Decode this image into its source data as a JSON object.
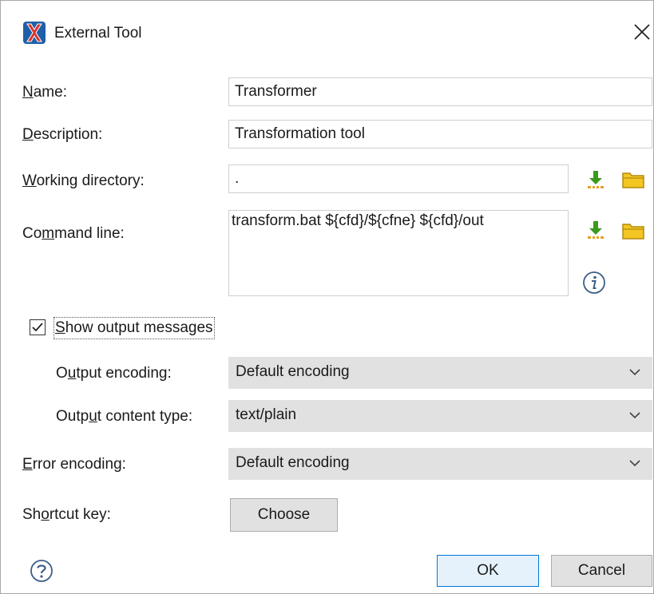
{
  "window": {
    "title": "External Tool"
  },
  "form": {
    "name_label_mnemonic": "N",
    "name_label_rest": "ame:",
    "name_value": "Transformer",
    "description_label_mnemonic": "D",
    "description_label_rest": "escription:",
    "description_value": "Transformation tool",
    "workdir_label_mnemonic": "W",
    "workdir_label_rest": "orking directory:",
    "workdir_value": ".",
    "cmd_label_pre": "Co",
    "cmd_label_mnemonic": "m",
    "cmd_label_rest": "mand line:",
    "cmd_value": "transform.bat ${cfd}/${cfne} ${cfd}/out",
    "show_output_checked": true,
    "show_output_mnemonic": "S",
    "show_output_rest": "how output messages",
    "out_enc_label_pre": "O",
    "out_enc_label_mnemonic": "u",
    "out_enc_label_rest": "tput encoding:",
    "out_enc_value": "Default encoding",
    "out_ct_label_pre": "Outp",
    "out_ct_label_mnemonic": "u",
    "out_ct_label_rest": "t content type:",
    "out_ct_value": "text/plain",
    "err_enc_label_mnemonic": "E",
    "err_enc_label_rest": "rror encoding:",
    "err_enc_value": "Default encoding",
    "shortcut_label_pre": "Sh",
    "shortcut_label_mnemonic": "o",
    "shortcut_label_rest": "rtcut key:",
    "choose_label": "Choose"
  },
  "footer": {
    "ok_label": "OK",
    "cancel_label": "Cancel"
  },
  "icons": {
    "app": "oxygen-x-icon",
    "close": "close-icon",
    "insert_editor_variable": "download-arrow-icon",
    "browse": "folder-icon",
    "info": "info-icon",
    "help": "help-icon",
    "dropdown": "chevron-down-icon"
  },
  "colors": {
    "accent": "#0078d7",
    "arrow_green": "#3a9a1c",
    "folder_yellow": "#f3c623",
    "app_icon_red": "#d9342b"
  }
}
